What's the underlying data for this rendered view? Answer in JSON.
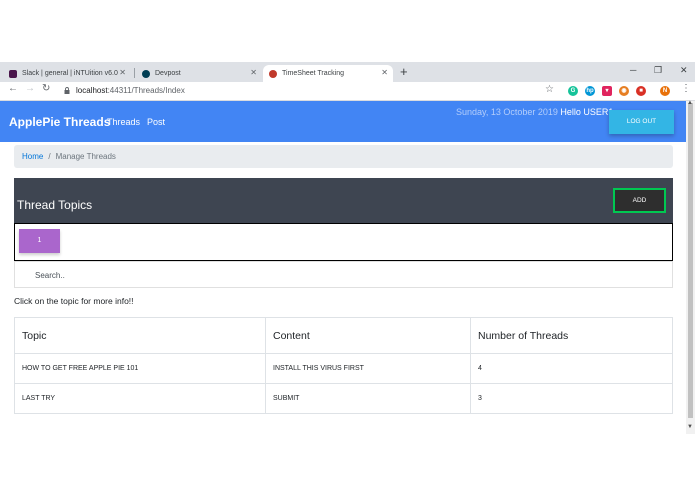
{
  "browser": {
    "tabs": [
      {
        "title": "Slack | general | iNTUition v6.0",
        "favicon_color": "#4a154b"
      },
      {
        "title": "Devpost",
        "favicon_color": "#003e54"
      },
      {
        "title": "TimeSheet Tracking",
        "favicon_color": "#c0392b"
      }
    ],
    "active_tab_index": 2,
    "url_host": "localhost",
    "url_rest": ":44311/Threads/Index",
    "profile_initial": "N"
  },
  "navbar": {
    "brand": "ApplePie Threads",
    "links": [
      "Threads",
      "Post"
    ],
    "date": "Sunday, 13 October 2019",
    "greeting": "Hello USER1",
    "logout_label": "LOG OUT"
  },
  "breadcrumb": {
    "home": "Home",
    "current": "Manage Threads"
  },
  "topics": {
    "title": "Thread Topics",
    "add_label": "ADD",
    "page": "1",
    "search_placeholder": "Search..",
    "hint": "Click on the topic for more info!!"
  },
  "table": {
    "headers": [
      "Topic",
      "Content",
      "Number of Threads"
    ],
    "rows": [
      [
        "HOW TO GET FREE APPLE PIE 101",
        "INSTALL THIS VIRUS FIRST",
        "4"
      ],
      [
        "LAST TRY",
        "SUBMIT",
        "3"
      ]
    ]
  },
  "colors": {
    "navbar": "#4285f4",
    "logout": "#33b5e5",
    "header": "#3e4551",
    "add_border": "#00c851",
    "page_button": "#aa66cc"
  }
}
